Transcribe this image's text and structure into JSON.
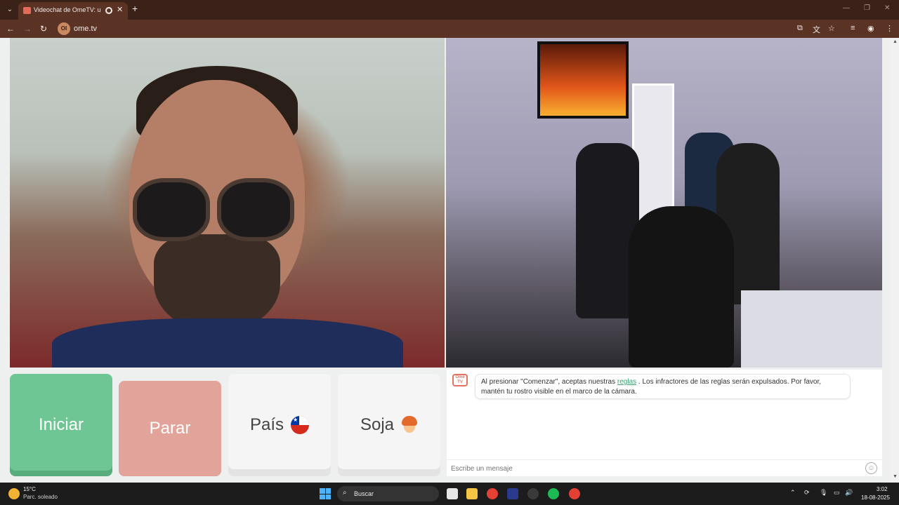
{
  "browser": {
    "tab_title": "Videochat de OmeTV: uno",
    "url": "ome.tv",
    "site_icon_text": "OI",
    "icons": {
      "tab_menu": "chevron-down-icon",
      "tab_close": "close-icon",
      "new_tab": "plus-icon",
      "back": "arrow-left-icon",
      "forward": "arrow-right-icon",
      "reload": "reload-icon",
      "cast": "cast-icon",
      "translate": "translate-icon",
      "bookmark": "star-icon",
      "media": "media-icon",
      "profile": "profile-icon",
      "menu": "kebab-menu-icon"
    }
  },
  "controls": {
    "start_label": "Iniciar",
    "stop_label": "Parar",
    "country_label": "País",
    "country_flag": "chile-flag",
    "gender_label": "Soja",
    "gender_icon": "boy-avatar-icon"
  },
  "chat": {
    "logo_text": "Ome TV",
    "message_prefix": "Al presionar \"Comenzar\", aceptas nuestras",
    "rules_link": "reglas",
    "message_suffix": ". Los infractores de las reglas serán expulsados. Por favor, mantén tu rostro visible en el marco de la cámara.",
    "input_placeholder": "Escribe un mensaje"
  },
  "taskbar": {
    "weather_temp": "15°C",
    "weather_desc": "Parc. soleado",
    "search_placeholder": "Buscar",
    "time": "3:02",
    "date": "18-08-2025"
  },
  "colors": {
    "start_button": "#6dc693",
    "stop_button": "#e2a49a",
    "rules_link": "#3aa072",
    "browser_frame": "#5a3324"
  }
}
